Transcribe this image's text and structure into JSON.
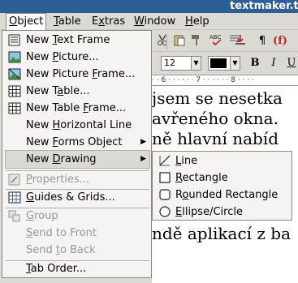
{
  "window": {
    "title": "textmaker.tr"
  },
  "menubar": {
    "items": [
      {
        "label": "Object"
      },
      {
        "label": "Table"
      },
      {
        "label": "Extras"
      },
      {
        "label": "Window"
      },
      {
        "label": "Help"
      }
    ]
  },
  "toolbar": {
    "font_size": "12",
    "paragraph_mark": "¶",
    "field_mark": "(f)",
    "bold": "B",
    "italic": "I",
    "underline": "U",
    "ruler_text": "· · 6 · · · · · · 7 · · · · · · 8 · · · ·"
  },
  "document": {
    "lines": [
      "jsem se nesetka",
      "avřeného okna.",
      "ně hlavní nabíd",
      "",
      "",
      "",
      "",
      "ndě aplikací z ba"
    ]
  },
  "object_menu": {
    "items": [
      {
        "label": "New Text Frame",
        "mnemonic_index": 4,
        "icon": "text-frame-icon",
        "enabled": true
      },
      {
        "label": "New Picture...",
        "mnemonic_index": 4,
        "icon": "picture-icon",
        "enabled": true
      },
      {
        "label": "New Picture Frame...",
        "mnemonic_index": 12,
        "icon": "picture-frame-icon",
        "enabled": true
      },
      {
        "label": "New Table...",
        "mnemonic_index": 5,
        "icon": "table-icon",
        "enabled": true
      },
      {
        "label": "New Table Frame...",
        "mnemonic_index": 10,
        "icon": "table-frame-icon",
        "enabled": true
      },
      {
        "label": "New Horizontal Line",
        "mnemonic_index": 4,
        "icon": "",
        "enabled": true
      },
      {
        "label": "New Forms Object",
        "mnemonic_index": 4,
        "icon": "",
        "enabled": true,
        "submenu": true
      },
      {
        "label": "New Drawing",
        "mnemonic_index": 4,
        "icon": "",
        "enabled": true,
        "submenu": true,
        "highlighted": true
      },
      {
        "label": "Properties...",
        "mnemonic_index": 0,
        "icon": "properties-icon",
        "enabled": false
      },
      {
        "label": "Guides & Grids...",
        "mnemonic_index": 0,
        "icon": "grid-icon",
        "enabled": true
      },
      {
        "label": "Group",
        "mnemonic_index": 0,
        "icon": "group-icon",
        "enabled": false
      },
      {
        "label": "Send to Front",
        "mnemonic_index": 0,
        "icon": "",
        "enabled": false
      },
      {
        "label": "Send to Back",
        "mnemonic_index": 5,
        "icon": "",
        "enabled": false
      },
      {
        "label": "Tab Order...",
        "mnemonic_index": 0,
        "icon": "",
        "enabled": true
      }
    ]
  },
  "drawing_submenu": {
    "items": [
      {
        "label": "Line",
        "mnemonic_index": 0,
        "icon": "line-icon"
      },
      {
        "label": "Rectangle",
        "mnemonic_index": 0,
        "icon": "rectangle-icon"
      },
      {
        "label": "Rounded Rectangle",
        "mnemonic_index": 1,
        "icon": "rounded-rectangle-icon"
      },
      {
        "label": "Ellipse/Circle",
        "mnemonic_index": 0,
        "icon": "ellipse-icon"
      }
    ]
  },
  "colors": {
    "titlebar": "#2d5f96",
    "menu_bg": "#f5f4f2",
    "disabled_text": "#9a9791"
  }
}
